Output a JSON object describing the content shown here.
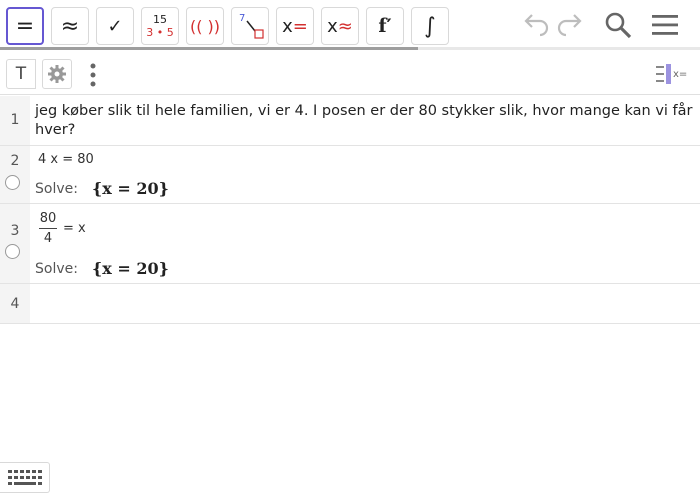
{
  "toolbar": {
    "buttons": [
      {
        "name": "symbolic-eval",
        "label": "="
      },
      {
        "name": "numeric-eval",
        "label": "≈"
      },
      {
        "name": "check-input",
        "label": "✓"
      },
      {
        "name": "factor",
        "top": "15",
        "bottom": "3 • 5"
      },
      {
        "name": "expand",
        "label": "(( ))"
      },
      {
        "name": "substitute",
        "label": "7"
      },
      {
        "name": "solve",
        "label": "x",
        "red": "="
      },
      {
        "name": "solve-numeric",
        "label": "x",
        "red": "≈"
      },
      {
        "name": "derivative",
        "label": "f′"
      },
      {
        "name": "integral",
        "label": "∫"
      }
    ],
    "icons": [
      "undo-icon",
      "redo-icon",
      "search-icon",
      "menu-icon"
    ],
    "accent": "#6557d2",
    "progress": 0.6
  },
  "bar2": {
    "text_label": "T",
    "icons": [
      "text-icon",
      "gear-icon",
      "more-vertical-icon",
      "algebra-view-icon"
    ]
  },
  "rows": [
    {
      "num": "1",
      "text": "jeg køber slik til hele familien, vi er 4. I posen er der 80 stykker slik, hvor mange kan vi får hver?"
    },
    {
      "num": "2",
      "expr": "4 x = 80",
      "solve_label": "Solve:",
      "solve_value": "{x = 20}"
    },
    {
      "num": "3",
      "frac_num": "80",
      "frac_den": "4",
      "expr_rest": "= x",
      "solve_label": "Solve:",
      "solve_value": "{x = 20}"
    },
    {
      "num": "4"
    }
  ]
}
